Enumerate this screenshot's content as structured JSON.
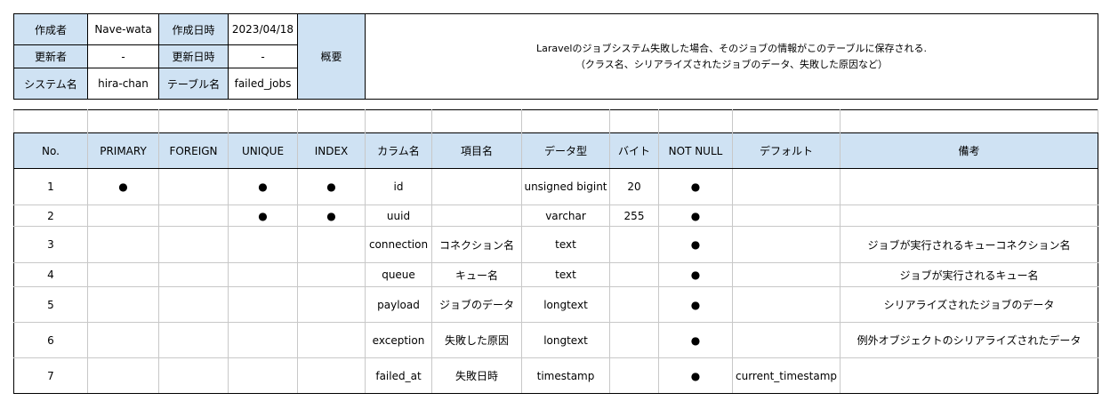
{
  "meta": {
    "author_label": "作成者",
    "author_value": "Nave-wata",
    "created_label": "作成日時",
    "created_value": "2023/04/18",
    "updater_label": "更新者",
    "updater_value": "-",
    "updated_label": "更新日時",
    "updated_value": "-",
    "system_label": "システム名",
    "system_value": "hira-chan",
    "table_label": "テーブル名",
    "table_value": "failed_jobs",
    "overview_label": "概要",
    "overview_line1": "Laravelのジョブシステム失敗した場合、そのジョブの情報がこのテーブルに保存される.",
    "overview_line2": "（クラス名、シリアライズされたジョブのデータ、失敗した原因など）"
  },
  "columns": {
    "headers": [
      "No.",
      "PRIMARY",
      "FOREIGN",
      "UNIQUE",
      "INDEX",
      "カラム名",
      "項目名",
      "データ型",
      "バイト",
      "NOT NULL",
      "デフォルト",
      "備考"
    ],
    "rows": [
      [
        "1",
        "●",
        "",
        "●",
        "●",
        "id",
        "",
        "unsigned bigint",
        "20",
        "●",
        "",
        ""
      ],
      [
        "2",
        "",
        "",
        "●",
        "●",
        "uuid",
        "",
        "varchar",
        "255",
        "●",
        "",
        ""
      ],
      [
        "3",
        "",
        "",
        "",
        "",
        "connection",
        "コネクション名",
        "text",
        "",
        "●",
        "",
        "ジョブが実行されるキューコネクション名"
      ],
      [
        "4",
        "",
        "",
        "",
        "",
        "queue",
        "キュー名",
        "text",
        "",
        "●",
        "",
        "ジョブが実行されるキュー名"
      ],
      [
        "5",
        "",
        "",
        "",
        "",
        "payload",
        "ジョブのデータ",
        "longtext",
        "",
        "●",
        "",
        "シリアライズされたジョブのデータ"
      ],
      [
        "6",
        "",
        "",
        "",
        "",
        "exception",
        "失敗した原因",
        "longtext",
        "",
        "●",
        "",
        "例外オブジェクトのシリアライズされたデータ"
      ],
      [
        "7",
        "",
        "",
        "",
        "",
        "failed_at",
        "失敗日時",
        "timestamp",
        "",
        "●",
        "current_timestamp",
        ""
      ]
    ]
  }
}
